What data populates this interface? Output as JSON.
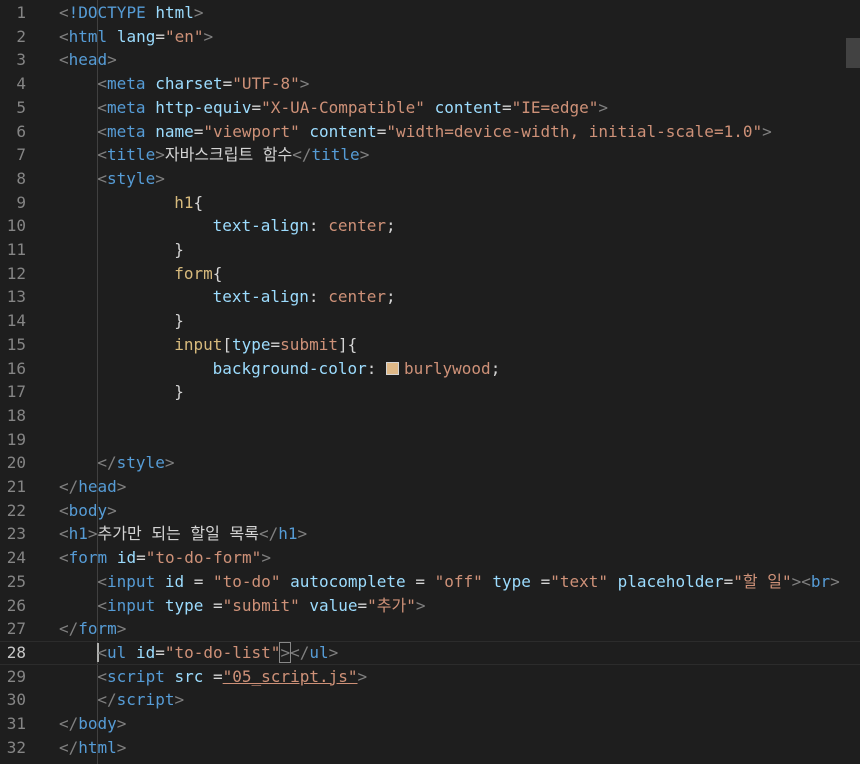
{
  "editor": {
    "language": "html",
    "active_line": 28,
    "lines": [
      {
        "n": "1",
        "tokens": [
          [
            "p",
            "<"
          ],
          [
            "t",
            "!DOCTYPE"
          ],
          [
            "x",
            " "
          ],
          [
            "a",
            "html"
          ],
          [
            "p",
            ">"
          ]
        ]
      },
      {
        "n": "2",
        "tokens": [
          [
            "p",
            "<"
          ],
          [
            "t",
            "html"
          ],
          [
            "x",
            " "
          ],
          [
            "a",
            "lang"
          ],
          [
            "x",
            "="
          ],
          [
            "s",
            "\"en\""
          ],
          [
            "p",
            ">"
          ]
        ]
      },
      {
        "n": "3",
        "tokens": [
          [
            "p",
            "<"
          ],
          [
            "t",
            "head"
          ],
          [
            "p",
            ">"
          ]
        ]
      },
      {
        "n": "4",
        "indent": 1,
        "tokens": [
          [
            "p",
            "<"
          ],
          [
            "t",
            "meta"
          ],
          [
            "x",
            " "
          ],
          [
            "a",
            "charset"
          ],
          [
            "x",
            "="
          ],
          [
            "s",
            "\"UTF-8\""
          ],
          [
            "p",
            ">"
          ]
        ]
      },
      {
        "n": "5",
        "indent": 1,
        "tokens": [
          [
            "p",
            "<"
          ],
          [
            "t",
            "meta"
          ],
          [
            "x",
            " "
          ],
          [
            "a",
            "http-equiv"
          ],
          [
            "x",
            "="
          ],
          [
            "s",
            "\"X-UA-Compatible\""
          ],
          [
            "x",
            " "
          ],
          [
            "a",
            "content"
          ],
          [
            "x",
            "="
          ],
          [
            "s",
            "\"IE=edge\""
          ],
          [
            "p",
            ">"
          ]
        ]
      },
      {
        "n": "6",
        "indent": 1,
        "tokens": [
          [
            "p",
            "<"
          ],
          [
            "t",
            "meta"
          ],
          [
            "x",
            " "
          ],
          [
            "a",
            "name"
          ],
          [
            "x",
            "="
          ],
          [
            "s",
            "\"viewport\""
          ],
          [
            "x",
            " "
          ],
          [
            "a",
            "content"
          ],
          [
            "x",
            "="
          ],
          [
            "s",
            "\"width=device-width, initial-scale=1.0\""
          ],
          [
            "p",
            ">"
          ]
        ]
      },
      {
        "n": "7",
        "indent": 1,
        "tokens": [
          [
            "p",
            "<"
          ],
          [
            "t",
            "title"
          ],
          [
            "p",
            ">"
          ],
          [
            "x",
            "자바스크립트 함수"
          ],
          [
            "p",
            "</"
          ],
          [
            "t",
            "title"
          ],
          [
            "p",
            ">"
          ]
        ]
      },
      {
        "n": "8",
        "indent": 1,
        "tokens": [
          [
            "p",
            "<"
          ],
          [
            "t",
            "style"
          ],
          [
            "p",
            ">"
          ]
        ]
      },
      {
        "n": "9",
        "indent": 3,
        "tokens": [
          [
            "y",
            "h1"
          ],
          [
            "x",
            "{"
          ]
        ]
      },
      {
        "n": "10",
        "indent": 4,
        "tokens": [
          [
            "a",
            "text-align"
          ],
          [
            "x",
            ": "
          ],
          [
            "s",
            "center"
          ],
          [
            "x",
            ";"
          ]
        ]
      },
      {
        "n": "11",
        "indent": 3,
        "tokens": [
          [
            "x",
            "}"
          ]
        ]
      },
      {
        "n": "12",
        "indent": 3,
        "tokens": [
          [
            "y",
            "form"
          ],
          [
            "x",
            "{"
          ]
        ]
      },
      {
        "n": "13",
        "indent": 4,
        "tokens": [
          [
            "a",
            "text-align"
          ],
          [
            "x",
            ": "
          ],
          [
            "s",
            "center"
          ],
          [
            "x",
            ";"
          ]
        ]
      },
      {
        "n": "14",
        "indent": 3,
        "tokens": [
          [
            "x",
            "}"
          ]
        ]
      },
      {
        "n": "15",
        "indent": 3,
        "tokens": [
          [
            "y",
            "input"
          ],
          [
            "x",
            "["
          ],
          [
            "a",
            "type"
          ],
          [
            "x",
            "="
          ],
          [
            "s",
            "submit"
          ],
          [
            "x",
            "]{"
          ]
        ]
      },
      {
        "n": "16",
        "indent": 4,
        "tokens": [
          [
            "a",
            "background-color"
          ],
          [
            "x",
            ": "
          ],
          [
            "swatch",
            ""
          ],
          [
            "s",
            "burlywood"
          ],
          [
            "x",
            ";"
          ]
        ]
      },
      {
        "n": "17",
        "indent": 3,
        "tokens": [
          [
            "x",
            "}"
          ]
        ]
      },
      {
        "n": "18",
        "tokens": []
      },
      {
        "n": "19",
        "tokens": []
      },
      {
        "n": "20",
        "indent": 1,
        "tokens": [
          [
            "p",
            "</"
          ],
          [
            "t",
            "style"
          ],
          [
            "p",
            ">"
          ]
        ]
      },
      {
        "n": "21",
        "tokens": [
          [
            "p",
            "</"
          ],
          [
            "t",
            "head"
          ],
          [
            "p",
            ">"
          ]
        ]
      },
      {
        "n": "22",
        "tokens": [
          [
            "p",
            "<"
          ],
          [
            "t",
            "body"
          ],
          [
            "p",
            ">"
          ]
        ]
      },
      {
        "n": "23",
        "tokens": [
          [
            "p",
            "<"
          ],
          [
            "t",
            "h1"
          ],
          [
            "p",
            ">"
          ],
          [
            "x",
            "추가만 되는 할일 목록"
          ],
          [
            "p",
            "</"
          ],
          [
            "t",
            "h1"
          ],
          [
            "p",
            ">"
          ]
        ]
      },
      {
        "n": "24",
        "tokens": [
          [
            "p",
            "<"
          ],
          [
            "t",
            "form"
          ],
          [
            "x",
            " "
          ],
          [
            "a",
            "id"
          ],
          [
            "x",
            "="
          ],
          [
            "s",
            "\"to-do-form\""
          ],
          [
            "p",
            ">"
          ]
        ]
      },
      {
        "n": "25",
        "indent": 1,
        "tokens": [
          [
            "p",
            "<"
          ],
          [
            "t",
            "input"
          ],
          [
            "x",
            " "
          ],
          [
            "a",
            "id"
          ],
          [
            "x",
            " = "
          ],
          [
            "s",
            "\"to-do\""
          ],
          [
            "x",
            " "
          ],
          [
            "a",
            "autocomplete"
          ],
          [
            "x",
            " = "
          ],
          [
            "s",
            "\"off\""
          ],
          [
            "x",
            " "
          ],
          [
            "a",
            "type"
          ],
          [
            "x",
            " ="
          ],
          [
            "s",
            "\"text\""
          ],
          [
            "x",
            " "
          ],
          [
            "a",
            "placeholder"
          ],
          [
            "x",
            "="
          ],
          [
            "s",
            "\"할 일\""
          ],
          [
            "p",
            ">"
          ],
          [
            "p",
            "<"
          ],
          [
            "t",
            "br"
          ],
          [
            "p",
            ">"
          ]
        ]
      },
      {
        "n": "26",
        "indent": 1,
        "tokens": [
          [
            "p",
            "<"
          ],
          [
            "t",
            "input"
          ],
          [
            "x",
            " "
          ],
          [
            "a",
            "type"
          ],
          [
            "x",
            " ="
          ],
          [
            "s",
            "\"submit\""
          ],
          [
            "x",
            " "
          ],
          [
            "a",
            "value"
          ],
          [
            "x",
            "="
          ],
          [
            "s",
            "\"추가\""
          ],
          [
            "p",
            ">"
          ]
        ]
      },
      {
        "n": "27",
        "tokens": [
          [
            "p",
            "</"
          ],
          [
            "t",
            "form"
          ],
          [
            "p",
            ">"
          ]
        ]
      },
      {
        "n": "28",
        "indent": 1,
        "tokens": [
          [
            "cursor",
            ""
          ],
          [
            "p",
            "<"
          ],
          [
            "t",
            "ul"
          ],
          [
            "x",
            " "
          ],
          [
            "a",
            "id"
          ],
          [
            "x",
            "="
          ],
          [
            "s",
            "\"to-do-list\""
          ],
          [
            "pb",
            ">"
          ],
          [
            "p",
            "</"
          ],
          [
            "t",
            "ul"
          ],
          [
            "p",
            ">"
          ]
        ]
      },
      {
        "n": "29",
        "indent": 1,
        "tokens": [
          [
            "p",
            "<"
          ],
          [
            "t",
            "script"
          ],
          [
            "x",
            " "
          ],
          [
            "a",
            "src"
          ],
          [
            "x",
            " ="
          ],
          [
            "su",
            "\"05_script.js\""
          ],
          [
            "p",
            ">"
          ]
        ]
      },
      {
        "n": "30",
        "indent": 1,
        "tokens": [
          [
            "p",
            "</"
          ],
          [
            "t",
            "script"
          ],
          [
            "p",
            ">"
          ]
        ]
      },
      {
        "n": "31",
        "tokens": [
          [
            "p",
            "</"
          ],
          [
            "t",
            "body"
          ],
          [
            "p",
            ">"
          ]
        ]
      },
      {
        "n": "32",
        "tokens": [
          [
            "p",
            "</"
          ],
          [
            "t",
            "html"
          ],
          [
            "p",
            ">"
          ]
        ]
      }
    ]
  }
}
